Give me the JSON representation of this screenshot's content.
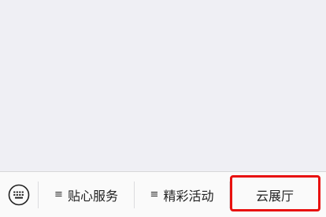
{
  "menu_bar": {
    "keyboard_icon": "keyboard-icon",
    "items": [
      {
        "label": "贴心服务",
        "prefix": "≡",
        "has_submenu": true
      },
      {
        "label": "精彩活动",
        "prefix": "≡",
        "has_submenu": true
      },
      {
        "label": "云展厅",
        "prefix": "",
        "has_submenu": false
      }
    ]
  },
  "colors": {
    "background": "#efeff4",
    "menu_bar": "#fafafa",
    "highlight": "#e8110f"
  }
}
